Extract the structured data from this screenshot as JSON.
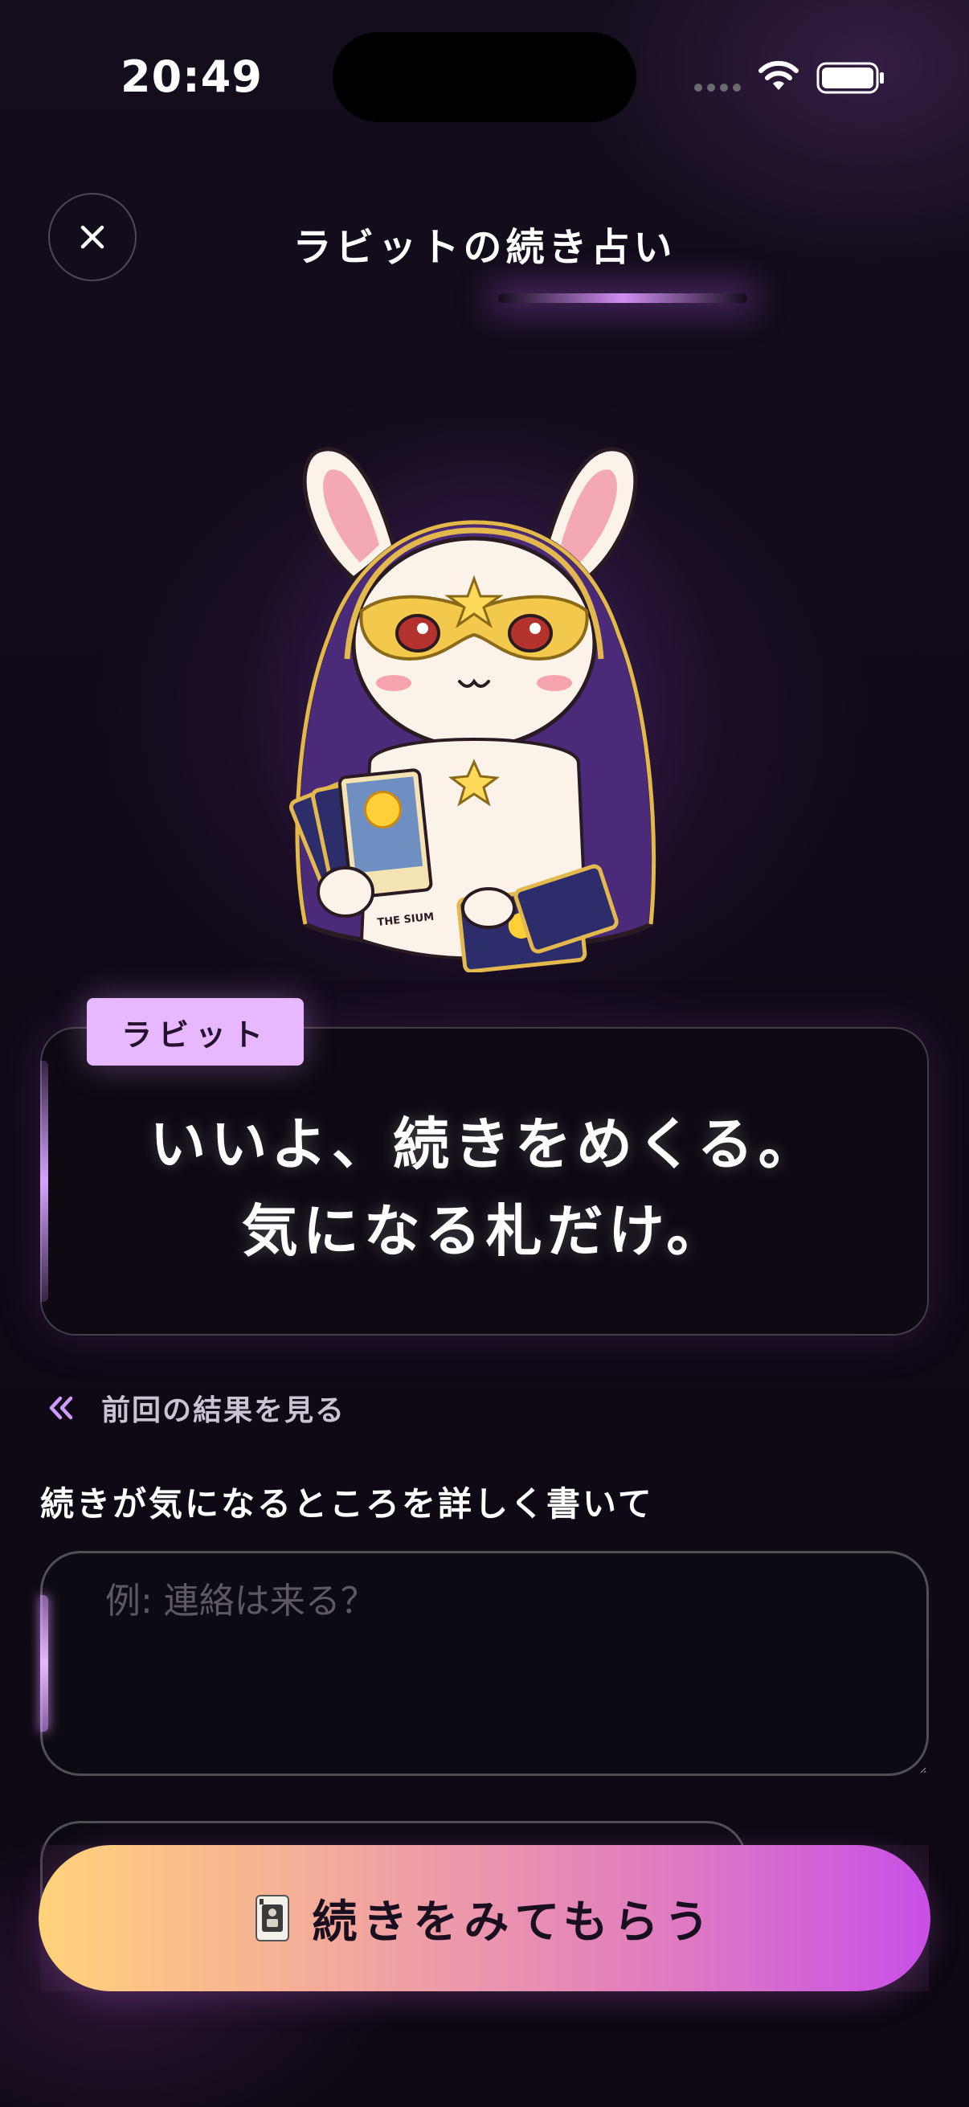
{
  "status_bar": {
    "time": "20:49"
  },
  "header": {
    "title": "ラビットの続き占い",
    "close_icon": "close-icon"
  },
  "mascot": {
    "card_caption": "THE SIUM"
  },
  "speech": {
    "speaker": "ラビット",
    "line1": "いいよ、続きをめくる。",
    "line2": "気になる札だけ。"
  },
  "prev_result": {
    "icon": "double-chevron-left-icon",
    "label": "前回の結果を見る"
  },
  "form": {
    "label": "続きが気になるところを詳しく書いて",
    "placeholder": "例: 連絡は来る？",
    "value": ""
  },
  "cta": {
    "icon": "playing-card-icon",
    "label": "続きをみてもらう"
  },
  "colors": {
    "accent_lilac": "#e7b8ff",
    "cta_gradient_start": "#ffd27a",
    "cta_gradient_end": "#c94fe6",
    "background": "#110a18"
  }
}
